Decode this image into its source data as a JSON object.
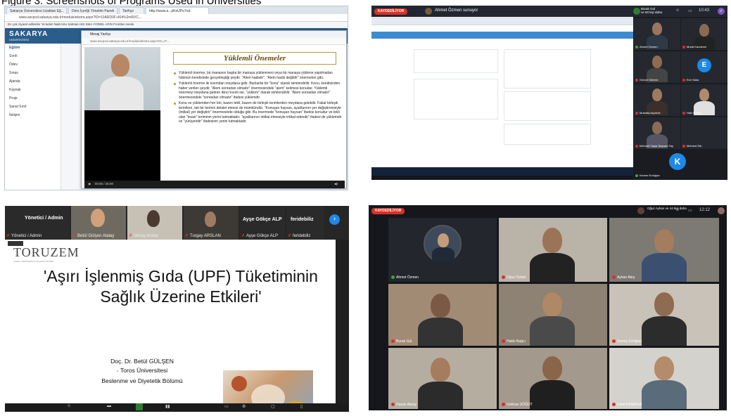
{
  "caption": "Figure 3. Screenshots of Programs Used in Universities",
  "panel1": {
    "tabs": [
      "Sakarya Üniversitesi Uzaktan Eğ...",
      "Ders İçeriği Yönetim Paneli",
      "Tarihçe",
      "http://www.a...pKeUPo7od"
    ],
    "address": "www.ascpcd.sakarya.edu.tr/moduls/ekstra.aspx?ID=10ARD0F+Kl4%2mRVC...",
    "bookmarks": "En çok ziyaret edilenler   Ye kelim   Naib Kitu Satmas   HIS SMA YORIEL AFIN   Frontlen Hesle",
    "logo": "SAKARYA",
    "logo_sub": "ÜNİVERSİTESİ",
    "sidebar": [
      "Eğitim",
      "Sınıfı",
      "Ödev",
      "Sınav",
      "Ajanda",
      "Kaynak",
      "Proje",
      "Sanal Sınıf",
      "İletişim"
    ],
    "popup_title": "Mesaj Yazlışı",
    "popup_url": "www.ascpcd.sakarya.edu.tr/moduls/ekstra.aspx?ID=J7...",
    "slide_title": "Yüklemli Önemeler",
    "slide_bullets": [
      "Yüklemli önerme, bir manasını başka bir manaya yüklenmesi veya bir manaya yüklene yapılmadan hükmün kendisinde gerçekleştiği şeydir. \"Alem hadistir\", \"Alem hadis değildir\" önermeleri gibi.",
      "Yüklemli önerme iki kısımdan meydana gelir. Bunlarda bir \"konu\" olarak isimlendirilir. Konu, kendisinden haber verilen şeydir. \"Alem sonradan olmadır\" önermesindeki \"alem\" kelimesi konudur. Yüklemli önermeyi meydana getiren ikinci kısım ise, \"yüklem\" olarak isimlendirilir. \"Alem sonradan olmadır\" önermesindeki \"sonradan olmadır\" ifadesi yüklemdir.",
      "Konu ve yüklemden her biri, bazen tekil, bazen de birleşik terimlerden meydana gelebilir. Fakat birleşik terimlere, tek bir terimin delalet etmesi de mümkündür. \"Konuşan hayvan, ayaklarının yer değiştirmesiyle (intikal) yer değiştirir\" önermesinde olduğu gibi. Bu önermede \"konuşan hayvan\" ifadesi konudur ve tekli olan \"insan\" teriminin yerini tutmaktadır. \"ayaklarının intikal etmesiyle intikal edendir\" ifadesi de yüklemdir ve \"yürüyendir\" ifadesinin yerini tutmaktadır."
    ],
    "time": "00:00 / 25:00"
  },
  "panel2": {
    "recording": "KAYDEDİLİYOR",
    "user": "Ahmet Özmen sunuyor",
    "count": "Burak Gül\nve 50 kişi daha",
    "time": "10:43",
    "tiles": [
      {
        "name": "Ahmet Özmen",
        "color": "#3c3f45"
      },
      {
        "name": "Murat Kandemir",
        "color": "#3c3f45"
      },
      {
        "name": "Gürsel Gülmez",
        "color": "#3c3f45"
      },
      {
        "name": "Ece Saka",
        "color": "#3c3f45"
      },
      {
        "name": "Mustafa Akyürek",
        "color": "#3c3f45"
      },
      {
        "name": "Halil Öztürk",
        "color": "#3c3f45"
      },
      {
        "name": "Mehmet Yaşar Bayram Taş",
        "color": "#3c3f45"
      },
      {
        "name": "Mehmet Dik",
        "color": "#3c3f45"
      },
      {
        "name": "Kevser Erdoğan",
        "color": "#3c3f45"
      }
    ],
    "avatar_e": "E",
    "avatar_k": "K"
  },
  "panel3": {
    "admin": "Yönetici / Admin",
    "tiles": [
      "Yönetici / Admin",
      "Betül Gülşen Atalay",
      "Simay Arslan",
      "Turgay ARSLAN",
      "Ayşe Gökçe ALP",
      "feridebiliz"
    ],
    "big_names": [
      "Ayşe Gökçe ALP",
      "feridebiliz"
    ],
    "logo": "TORUZEM",
    "logo_sub": "TOROS ÜNİVERSİTESİ UZAKTAN EĞİTİM",
    "title": "'Aşırı İşlenmiş Gıda (UPF) Tüketiminin Sağlık Üzerine Etkileri'",
    "author": [
      "Doç. Dr. Betül GÜLŞEN",
      "Toros Üniversitesi",
      "Beslenme ve Diyetetik Bölümü"
    ]
  },
  "panel4": {
    "recording": "KAYDEDİLİYOR",
    "count": "Oğuz Ayhan\nve 44 kişi daha",
    "time": "12:12",
    "cells": [
      {
        "name": "Ahmet Özmen"
      },
      {
        "name": "Oğuz Özbek"
      },
      {
        "name": "Ayhan Ateş"
      },
      {
        "name": "Burak Gül"
      },
      {
        "name": "Hakkı Bağcı"
      },
      {
        "name": "Sevinç Ertoğlan"
      },
      {
        "name": "Hasan Aksoy"
      },
      {
        "name": "Gökhan SÖĞÜT"
      },
      {
        "name": "Cahit KASIRGA"
      }
    ]
  }
}
